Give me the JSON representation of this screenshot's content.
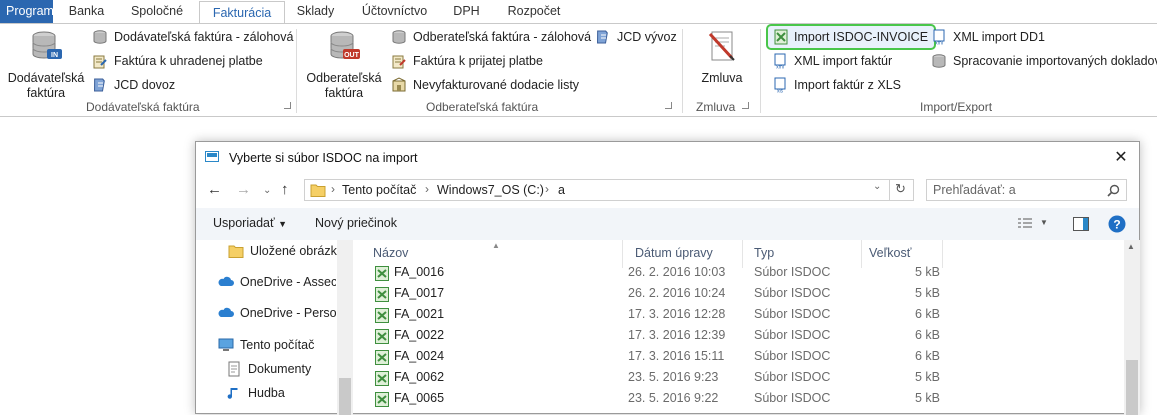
{
  "tabs": [
    "Program",
    "Banka",
    "Spoločné",
    "Fakturácia",
    "Sklady",
    "Účtovníctvo",
    "DPH",
    "Rozpočet"
  ],
  "ribbon": {
    "groups": {
      "dodavatelska": {
        "big_button_line1": "Dodávateľská",
        "big_button_line2": "faktúra",
        "items": [
          "Dodávateľská faktúra - zálohová",
          "Faktúra k uhradenej platbe",
          "JCD dovoz"
        ],
        "label": "Dodávateľská faktúra"
      },
      "odberatelska": {
        "big_button_line1": "Odberateľská",
        "big_button_line2": "faktúra",
        "items": [
          "Odberateľská faktúra - zálohová",
          "Faktúra k prijatej platbe",
          "Nevyfakturované dodacie listy",
          "JCD vývoz"
        ],
        "label": "Odberateľská faktúra"
      },
      "zmluva": {
        "big_button": "Zmluva",
        "label": "Zmluva"
      },
      "import_export": {
        "items": [
          "Import ISDOC-INVOICE",
          "XML import faktúr",
          "Import faktúr z XLS",
          "XML import DD1",
          "Spracovanie importovaných dokladov"
        ],
        "label": "Import/Export"
      }
    }
  },
  "dialog": {
    "title": "Vyberte si súbor ISDOC na import",
    "breadcrumbs": [
      "Tento počítač",
      "Windows7_OS (C:)",
      "a"
    ],
    "search_placeholder": "Prehľadávať: a",
    "organize_label": "Usporiadať",
    "new_folder_label": "Nový priečinok",
    "nav_items": [
      "Uložené obrázky",
      "OneDrive - Assecc",
      "OneDrive - Persor",
      "Tento počítač",
      "Dokumenty",
      "Hudba"
    ],
    "columns": {
      "name": "Názov",
      "date": "Dátum úpravy",
      "type": "Typ",
      "size": "Veľkosť"
    },
    "files": [
      {
        "name": "FA_0016",
        "date": "26. 2. 2016 10:03",
        "type": "Súbor ISDOC",
        "size": "5 kB"
      },
      {
        "name": "FA_0017",
        "date": "26. 2. 2016 10:24",
        "type": "Súbor ISDOC",
        "size": "5 kB"
      },
      {
        "name": "FA_0021",
        "date": "17. 3. 2016 12:28",
        "type": "Súbor ISDOC",
        "size": "6 kB"
      },
      {
        "name": "FA_0022",
        "date": "17. 3. 2016 12:39",
        "type": "Súbor ISDOC",
        "size": "6 kB"
      },
      {
        "name": "FA_0024",
        "date": "17. 3. 2016 15:11",
        "type": "Súbor ISDOC",
        "size": "6 kB"
      },
      {
        "name": "FA_0062",
        "date": "23. 5. 2016 9:23",
        "type": "Súbor ISDOC",
        "size": "5 kB"
      },
      {
        "name": "FA_0065",
        "date": "23. 5. 2016 9:22",
        "type": "Súbor ISDOC",
        "size": "5 kB"
      }
    ]
  },
  "colors": {
    "accent": "#2b67b0",
    "highlight_border": "#49c64a",
    "isdoc_icon": "#3f8f3f"
  },
  "icons": [
    "database-in-icon",
    "database-out-icon",
    "invoice-icon",
    "payment-icon",
    "jcd-icon",
    "contract-pen-icon",
    "isdoc-icon",
    "xml-icon",
    "xls-icon",
    "folder-icon",
    "onedrive-icon",
    "computer-icon",
    "documents-icon",
    "music-icon",
    "search-icon",
    "refresh-icon",
    "help-icon"
  ]
}
